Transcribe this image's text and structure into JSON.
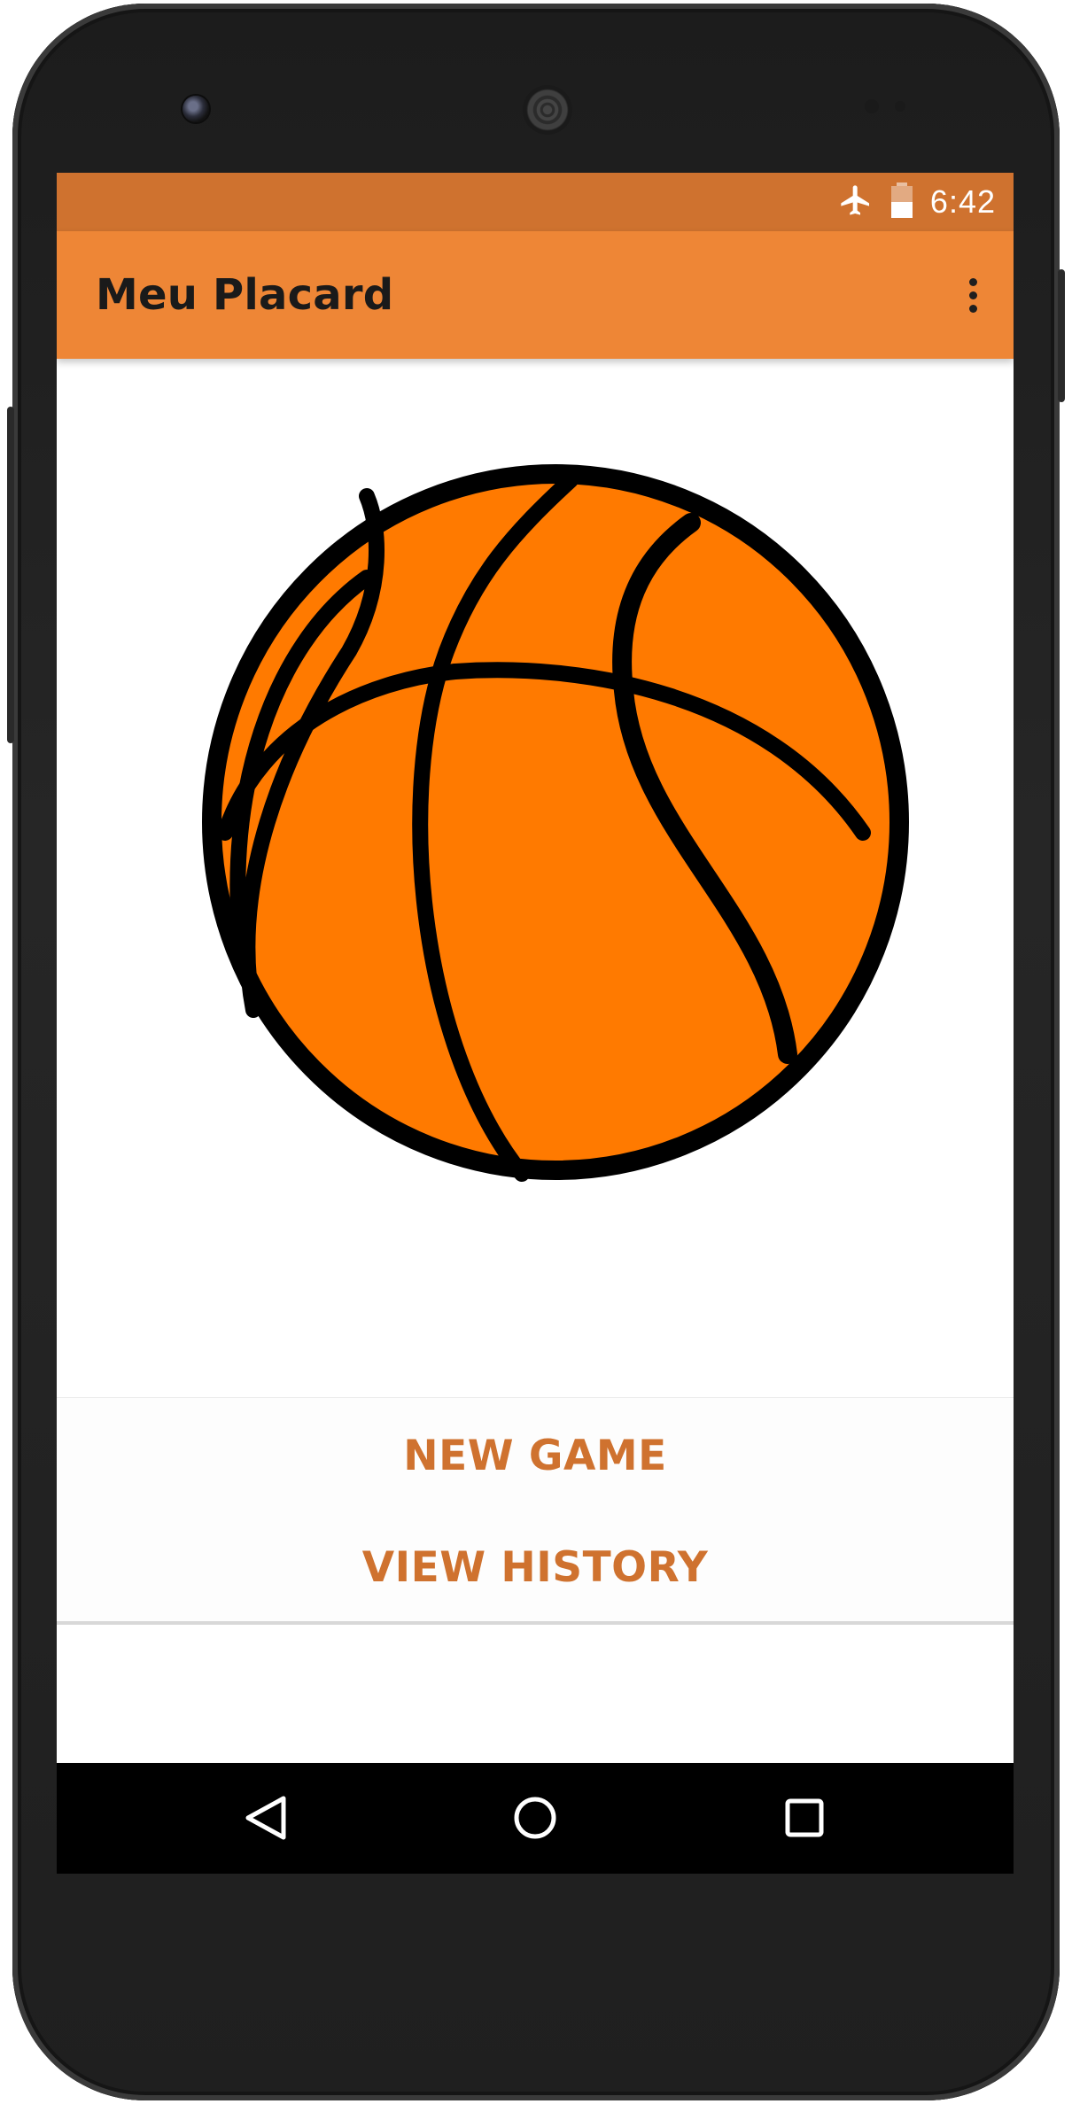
{
  "status_bar": {
    "time": "6:42",
    "icons": [
      "airplane-mode-icon",
      "battery-icon"
    ]
  },
  "app_bar": {
    "title": "Meu Placard",
    "menu_icon": "overflow-menu-icon"
  },
  "main": {
    "image": "basketball-illustration"
  },
  "actions": {
    "new_game_label": "NEW GAME",
    "view_history_label": "VIEW HISTORY"
  },
  "nav_bar": {
    "icons": [
      "back-icon",
      "home-icon",
      "recents-icon"
    ]
  },
  "colors": {
    "status_bar": "#cf722f",
    "app_bar": "#ee8636",
    "accent_text": "#cf722f",
    "ball_fill": "#ff7a00",
    "ball_stroke": "#000000"
  }
}
